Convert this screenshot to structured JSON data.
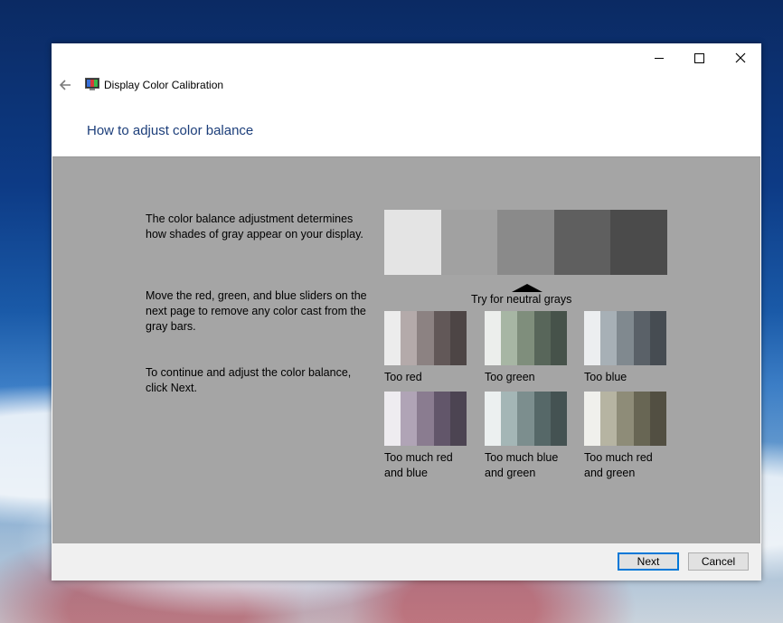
{
  "window": {
    "title": "Display Color Calibration",
    "heading": "How to adjust color balance"
  },
  "content": {
    "para1": "The color balance adjustment determines how shades of gray appear on your display.",
    "para2": "Move the red, green, and blue sliders on the next page to remove any color cast from the gray bars.",
    "para3": "To continue and adjust the color balance, click Next.",
    "neutral_label": "Try for neutral grays",
    "gray_bars": [
      "#e4e4e4",
      "#a1a1a1",
      "#8a8a8a",
      "#5f5f5f",
      "#4b4b4b"
    ],
    "samples": [
      {
        "label": "Too red",
        "colors": [
          "#ececec",
          "#b4aaaa",
          "#8c8282",
          "#625858",
          "#4d4545"
        ]
      },
      {
        "label": "Too green",
        "colors": [
          "#eceeec",
          "#a7b6a4",
          "#7f8e7c",
          "#58665a",
          "#46524a"
        ]
      },
      {
        "label": "Too blue",
        "colors": [
          "#eceef0",
          "#a7b0b6",
          "#80898f",
          "#5a6168",
          "#464c52"
        ]
      },
      {
        "label": "Too much red and blue",
        "colors": [
          "#eeecf0",
          "#b0a4b6",
          "#8a7c90",
          "#62566a",
          "#4c4452"
        ]
      },
      {
        "label": "Too much blue and green",
        "colors": [
          "#ecf0f0",
          "#a4b6b6",
          "#7c8e8e",
          "#566868",
          "#445252"
        ]
      },
      {
        "label": "Too much red and green",
        "colors": [
          "#f0f0ec",
          "#b6b4a2",
          "#8e8c78",
          "#686654",
          "#524f42"
        ]
      }
    ]
  },
  "footer": {
    "next": "Next",
    "cancel": "Cancel"
  },
  "colors": {
    "accent": "#0078d7",
    "heading": "#1c3e7a",
    "content_bg": "#a5a5a5"
  }
}
